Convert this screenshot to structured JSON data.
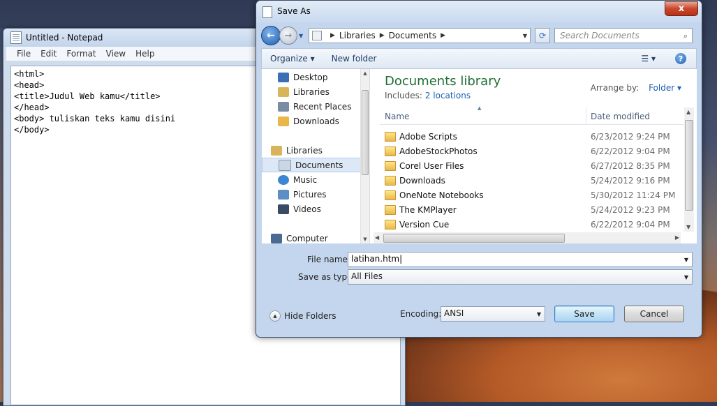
{
  "notepad": {
    "title": "Untitled - Notepad",
    "menu": [
      "File",
      "Edit",
      "Format",
      "View",
      "Help"
    ],
    "content": "<html>\n<head>\n<title>Judul Web kamu</title>\n</head>\n<body> tuliskan teks kamu disini\n</body>"
  },
  "dialog": {
    "title": "Save As",
    "close_label": "x",
    "breadcrumb": [
      "Libraries",
      "Documents"
    ],
    "search_placeholder": "Search Documents",
    "toolbar": {
      "organize": "Organize ▾",
      "new_folder": "New folder"
    },
    "nav": [
      {
        "label": "Desktop",
        "icon": "desktop-icon",
        "color": "#3b6fb6"
      },
      {
        "label": "Libraries",
        "icon": "libraries-icon",
        "color": "#d9b45a"
      },
      {
        "label": "Recent Places",
        "icon": "recent-places-icon",
        "color": "#7a8ca4"
      },
      {
        "label": "Downloads",
        "icon": "downloads-folder-icon",
        "color": "#e8b84a"
      },
      {
        "label": "Libraries",
        "icon": "libraries-icon",
        "color": "#d9b45a"
      },
      {
        "label": "Documents",
        "icon": "documents-icon",
        "color": "#c9d6e6"
      },
      {
        "label": "Music",
        "icon": "music-icon",
        "color": "#3d86d1"
      },
      {
        "label": "Pictures",
        "icon": "pictures-icon",
        "color": "#5b8fc4"
      },
      {
        "label": "Videos",
        "icon": "videos-icon",
        "color": "#3b4a63"
      },
      {
        "label": "Computer",
        "icon": "computer-icon",
        "color": "#4a6a94"
      }
    ],
    "library_title": "Documents library",
    "includes_label": "Includes:",
    "includes_link": "2 locations",
    "arrange_label": "Arrange by:",
    "arrange_value": "Folder",
    "columns": {
      "name": "Name",
      "date": "Date modified"
    },
    "files": [
      {
        "name": "Adobe Scripts",
        "date": "6/23/2012 9:24 PM"
      },
      {
        "name": "AdobeStockPhotos",
        "date": "6/22/2012 9:04 PM"
      },
      {
        "name": "Corel User Files",
        "date": "6/27/2012 8:35 PM"
      },
      {
        "name": "Downloads",
        "date": "5/24/2012 9:16 PM"
      },
      {
        "name": "OneNote Notebooks",
        "date": "5/30/2012 11:24 PM"
      },
      {
        "name": "The KMPlayer",
        "date": "5/24/2012 9:23 PM"
      },
      {
        "name": "Version Cue",
        "date": "6/22/2012 9:04 PM"
      }
    ],
    "file_name_label": "File name:",
    "file_name_value": "latihan.htm",
    "save_type_label": "Save as type:",
    "save_type_value": "All Files",
    "hide_folders": "Hide Folders",
    "encoding_label": "Encoding:",
    "encoding_value": "ANSI",
    "save_button": "Save",
    "cancel_button": "Cancel"
  }
}
